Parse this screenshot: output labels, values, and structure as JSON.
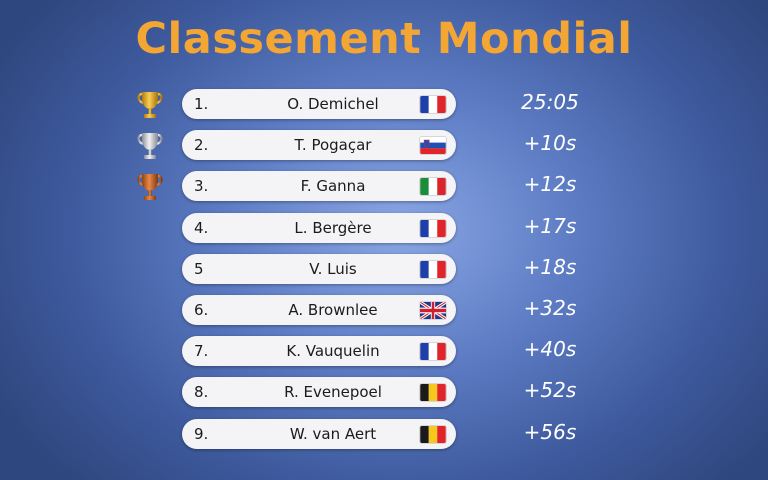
{
  "title": "Classement Mondial",
  "colors": {
    "title": "#f3a633",
    "gold": "#e2a21b",
    "silver": "#c2c4c8",
    "bronze": "#c56a2c"
  },
  "rows": [
    {
      "rank": "1.",
      "name": "O. Demichel",
      "flag": "france-flag",
      "time": "25:05",
      "trophy": "gold-trophy-icon"
    },
    {
      "rank": "2.",
      "name": "T. Pogaçar",
      "flag": "slovenia-flag",
      "time": "+10s",
      "trophy": "silver-trophy-icon"
    },
    {
      "rank": "3.",
      "name": "F. Ganna",
      "flag": "italy-flag",
      "time": "+12s",
      "trophy": "bronze-trophy-icon"
    },
    {
      "rank": "4.",
      "name": "L. Bergère",
      "flag": "france-flag",
      "time": "+17s"
    },
    {
      "rank": "5",
      "name": "V. Luis",
      "flag": "france-flag",
      "time": "+18s"
    },
    {
      "rank": "6.",
      "name": "A. Brownlee",
      "flag": "uk-flag",
      "time": "+32s"
    },
    {
      "rank": "7.",
      "name": "K. Vauquelin",
      "flag": "france-flag",
      "time": "+40s"
    },
    {
      "rank": "8.",
      "name": "R. Evenepoel",
      "flag": "belgium-flag",
      "time": "+52s"
    },
    {
      "rank": "9.",
      "name": "W. van Aert",
      "flag": "belgium-flag",
      "time": "+56s"
    }
  ]
}
